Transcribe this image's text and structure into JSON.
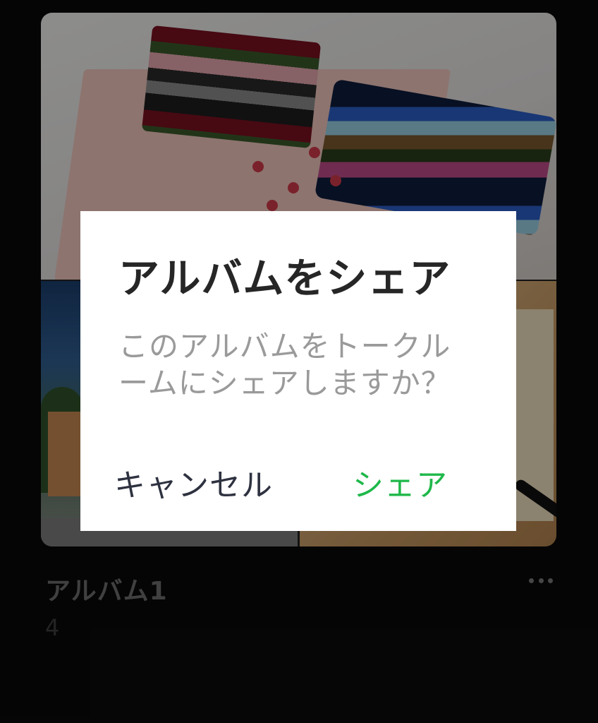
{
  "album": {
    "title": "アルバム1",
    "count": "4"
  },
  "dialog": {
    "title": "アルバムをシェア",
    "message_line1": "このアルバムをトークル",
    "message_line2": "ームにシェアしますか？",
    "cancel_label": "キャンセル",
    "share_label": "シェア"
  },
  "colors": {
    "share_accent": "#1fb84a",
    "background": "#0a0a0a",
    "dialog_bg": "#ffffff"
  },
  "icons": {
    "more": "more-horizontal-icon"
  }
}
